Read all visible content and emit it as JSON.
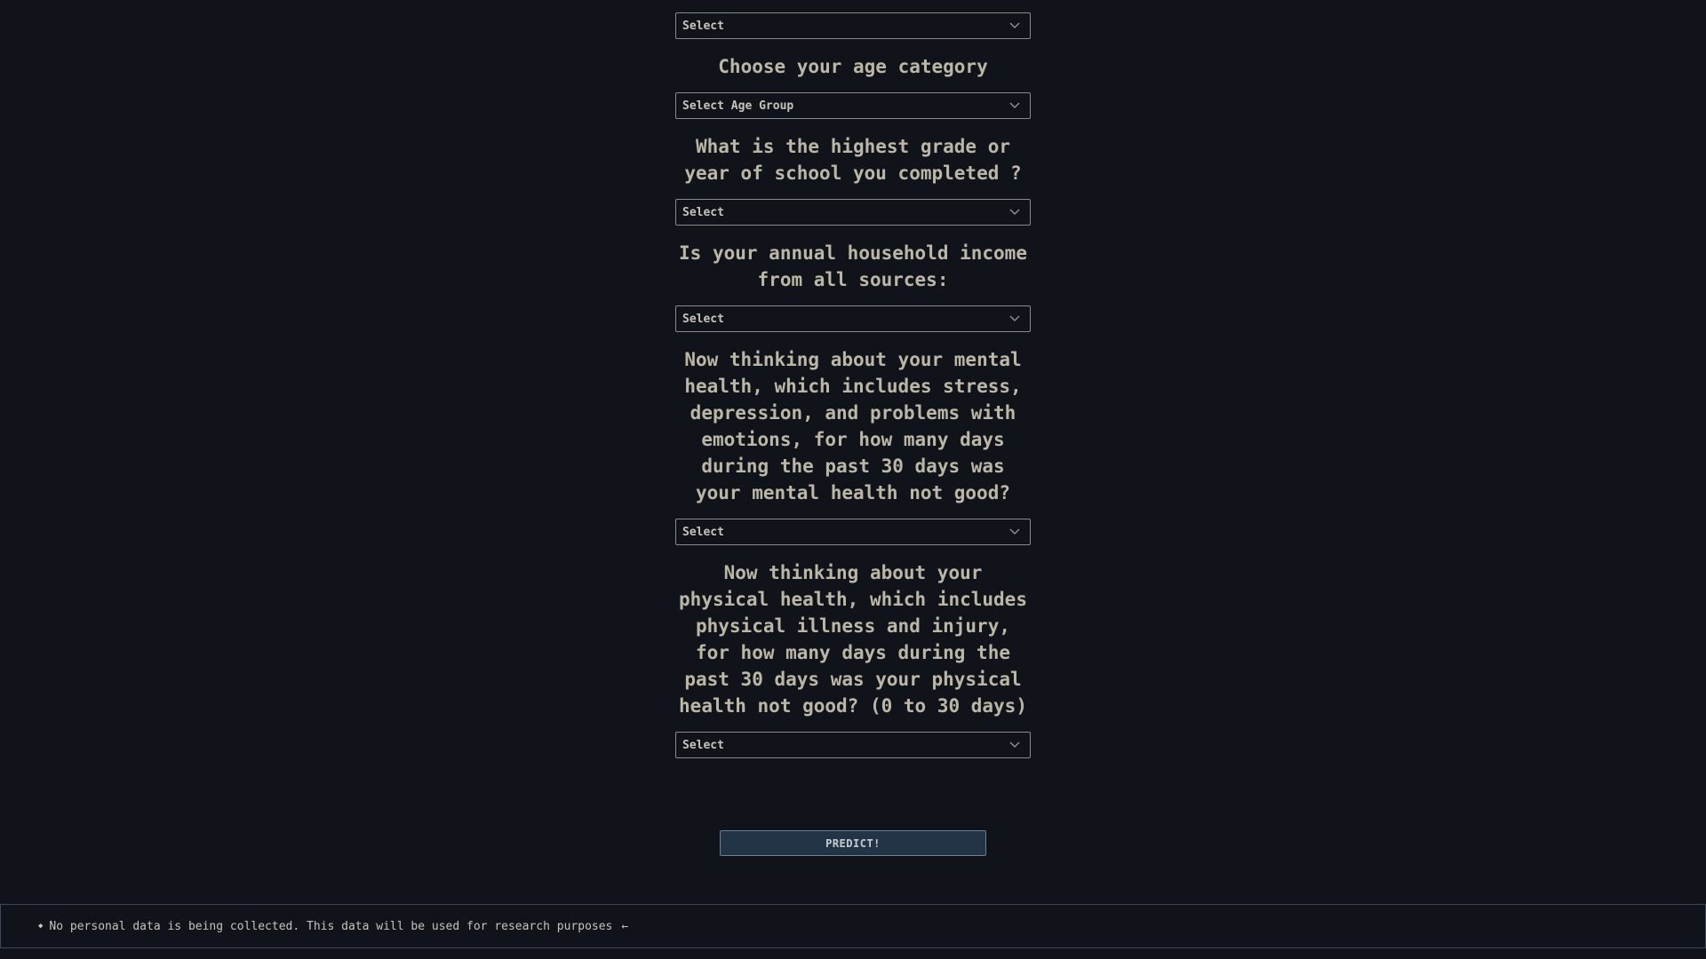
{
  "form": {
    "fields": [
      {
        "question": "",
        "select_value": "Select"
      },
      {
        "question": "Choose your age category",
        "select_value": "Select Age Group"
      },
      {
        "question": "What is the highest grade or year of school you completed ?",
        "select_value": "Select"
      },
      {
        "question": "Is your annual household income from all sources:",
        "select_value": "Select"
      },
      {
        "question": "Now thinking about your mental health, which includes stress, depression, and problems with emotions, for how many days during the past 30 days was your mental health not good?",
        "select_value": "Select"
      },
      {
        "question": "Now thinking about your physical health, which includes physical illness and injury, for how many days during the past 30 days was your physical health not good? (0 to 30 days)",
        "select_value": "Select"
      }
    ],
    "submit_label": "PREDICT!"
  },
  "footer": {
    "bullet": "◆",
    "notice": "No personal data is being collected. This data will be used for research purposes",
    "arrow": "←"
  },
  "icons": {
    "dropdown": "chevron-down-icon"
  },
  "colors": {
    "background": "#10141a",
    "text": "#bcb6a6",
    "button_bg": "#233447",
    "border": "#8a8a88"
  }
}
